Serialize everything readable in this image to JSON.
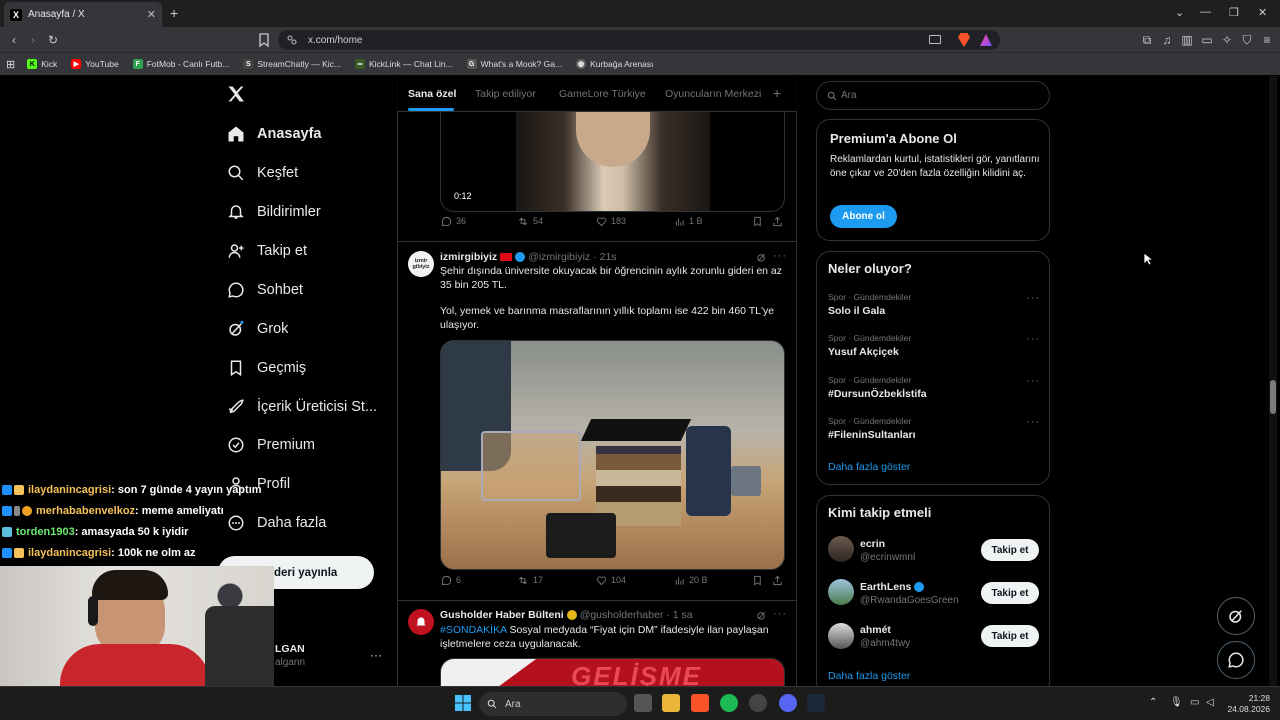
{
  "browser": {
    "tab_title": "Anasayfa / X",
    "url": "x.com/home",
    "bookmarks": [
      "Kick",
      "YouTube",
      "FotMob - Canlı Futb...",
      "StreamChatly — Kic...",
      "KickLink — Chat Lin...",
      "What's a Mook? Ga...",
      "Kurbağa Arenası"
    ]
  },
  "nav": {
    "logo": "X",
    "items": [
      "Anasayfa",
      "Keşfet",
      "Bildirimler",
      "Takip et",
      "Sohbet",
      "Grok",
      "Geçmiş",
      "İçerik Üreticisi St...",
      "Premium",
      "Profil",
      "Daha fazla"
    ],
    "post_button": "Gönderi yayınla",
    "post_button_visible": "deri yayınla",
    "account_name": "LGAN",
    "account_handle": "algann"
  },
  "feed": {
    "tabs": [
      "Sana özel",
      "Takip ediliyor",
      "GameLore Türkiye",
      "Oyuncuların Merkezi"
    ],
    "video_time": "0:12",
    "tweet1_stats": {
      "replies": "36",
      "reposts": "54",
      "likes": "183",
      "views": "1 B"
    },
    "tweet2": {
      "name": "izmirgibiyiz",
      "handle": "@izmirgibiyiz",
      "time": "· 21s",
      "avatar_text": "izmir gibiyiz",
      "text1": "Şehir dışında üniversite okuyacak bir öğrencinin aylık zorunlu gideri en az 35 bin 205 TL.",
      "text2": "Yol, yemek ve barınma masraflarının yıllık toplamı ise 422 bin 460 TL'ye ulaşıyor.",
      "stats": {
        "replies": "6",
        "reposts": "17",
        "likes": "104",
        "views": "20 B"
      }
    },
    "tweet3": {
      "name": "Gusholder Haber Bülteni",
      "handle": "@gusholderhaber",
      "time": "· 1 sa",
      "hashtag": "#SONDAKİKA",
      "text": " Sosyal medyada “Fiyat için DM” ifadesiyle ilan paylaşan işletmelere ceza uygulanacak.",
      "image_text": "GELİŞME"
    }
  },
  "right": {
    "search_placeholder": "Ara",
    "premium": {
      "title": "Premium'a Abone Ol",
      "body": "Reklamlardan kurtul, istatistikleri gör, yanıtlarını öne çıkar ve 20'den fazla özelliğin kilidini aç.",
      "button": "Abone ol"
    },
    "trends": {
      "title": "Neler oluyor?",
      "items": [
        {
          "meta": "Spor · Gündemdekiler",
          "name": "Solo il Gala"
        },
        {
          "meta": "Spor · Gündemdekiler",
          "name": "Yusuf Akçiçek"
        },
        {
          "meta": "Spor · Gündemdekiler",
          "name": "#DursunÖzbekİstifa"
        },
        {
          "meta": "Spor · Gündemdekiler",
          "name": "#FileninSultanları"
        }
      ],
      "more": "Daha fazla göster"
    },
    "who_to_follow": {
      "title": "Kimi takip etmeli",
      "users": [
        {
          "name": "ecrin",
          "handle": "@ecrinwmnl",
          "button": "Takip et"
        },
        {
          "name": "EarthLens",
          "handle": "@RwandaGoesGreen",
          "button": "Takip et"
        },
        {
          "name": "ahmét",
          "handle": "@ahm4twy",
          "button": "Takip et"
        }
      ],
      "more": "Daha fazla göster"
    }
  },
  "chat_overlay": [
    {
      "user": "ilaydanincagrisi",
      "msg": ": son 7 günde 4 yayın yaptım",
      "color": "#f5c15a"
    },
    {
      "user": "merhababenvelkoz",
      "msg": ": meme ameliyatı",
      "color": "#f5c15a"
    },
    {
      "user": "torden1903",
      "msg": ": amasyada 50 k iyidir",
      "color": "#6ee86e"
    },
    {
      "user": "ilaydanincagrisi",
      "msg": ": 100k ne olm az",
      "color": "#f5c15a"
    }
  ],
  "taskbar": {
    "search": "Ara",
    "time": "21:28",
    "date": "24.08.2026"
  },
  "colors": {
    "accent": "#1d9bf0",
    "bg": "#000000",
    "border": "#2f3336",
    "muted": "#71767b"
  }
}
